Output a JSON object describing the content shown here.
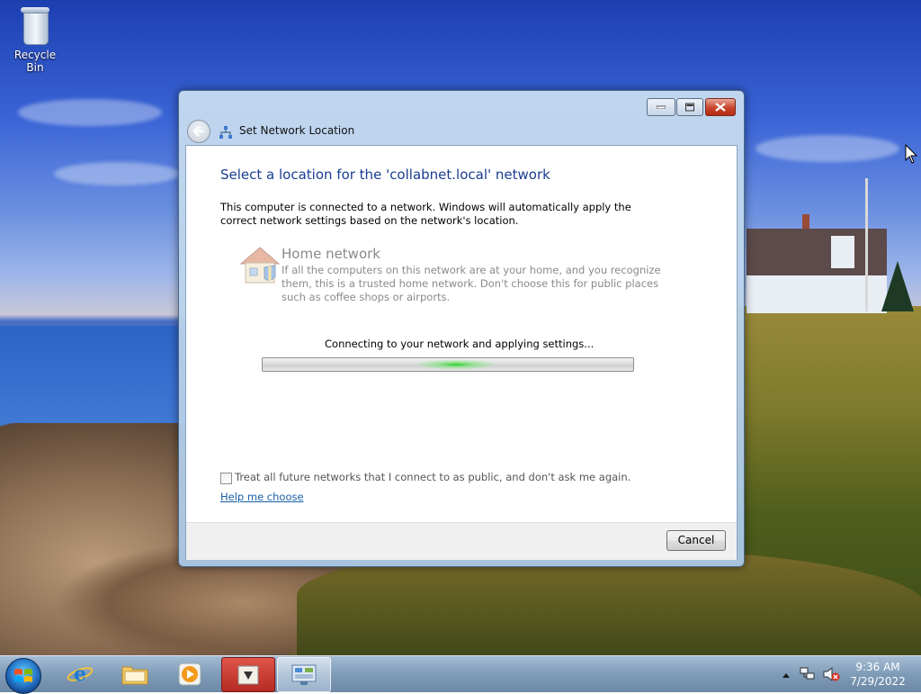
{
  "desktop": {
    "icons": [
      {
        "label": "Recycle Bin",
        "icon": "recycle-bin-icon"
      }
    ]
  },
  "window": {
    "title": "Set Network Location",
    "heading": "Select a location for the 'collabnet.local' network",
    "description": "This computer is connected to a network. Windows will automatically apply the correct network settings based on the network's location.",
    "home_network": {
      "title": "Home network",
      "description": "If all the computers on this network are at your home, and you recognize them, this is a trusted home network.  Don't choose this for public places such as coffee shops or airports."
    },
    "progress": {
      "label": "Connecting to your network and applying settings...",
      "indeterminate": true
    },
    "treat_public_checkbox": {
      "label": "Treat all future networks that I connect to as public, and don't ask me again.",
      "checked": false
    },
    "help_link": "Help me choose",
    "cancel_label": "Cancel"
  },
  "taskbar": {
    "buttons": [
      {
        "name": "internet-explorer",
        "icon": "internet-explorer-icon"
      },
      {
        "name": "windows-explorer",
        "icon": "folder-icon"
      },
      {
        "name": "media-player",
        "icon": "media-player-icon"
      },
      {
        "name": "app-red",
        "icon": "app-icon"
      },
      {
        "name": "network-control-panel",
        "icon": "control-panel-icon",
        "active": true
      }
    ],
    "tray": {
      "time": "9:36 AM",
      "date": "7/29/2022",
      "icons": [
        "show-hidden-icons-arrow",
        "network-tray-icon",
        "volume-muted-icon"
      ]
    }
  },
  "colors": {
    "heading": "#1a3d8f",
    "link": "#1a5fa6",
    "progress_glow": "#28d228",
    "close_button": "#c9442b"
  }
}
